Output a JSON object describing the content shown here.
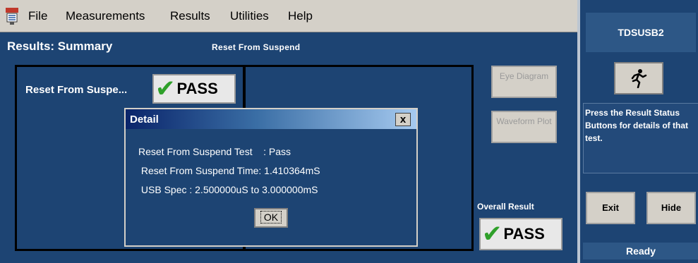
{
  "menu": {
    "items": [
      {
        "label": "File"
      },
      {
        "label": "Measurements"
      },
      {
        "label": "Results"
      },
      {
        "label": "Utilities"
      },
      {
        "label": "Help"
      }
    ]
  },
  "main": {
    "title": "Results: Summary",
    "subtitle": "Reset From Suspend",
    "test": {
      "label": "Reset From Suspe...",
      "result": "PASS"
    },
    "buttons": {
      "eye_diagram": "Eye Diagram",
      "waveform_plot": "Waveform Plot"
    },
    "overall_label": "Overall Result",
    "overall_result": "PASS"
  },
  "dialog": {
    "title": "Detail",
    "close": "x",
    "lines": [
      "Reset From Suspend Test    : Pass",
      " Reset From Suspend Time: 1.410364mS",
      " USB Spec : 2.500000uS to 3.000000mS"
    ],
    "ok": "OK"
  },
  "side_panel": {
    "title": "TDSUSB2",
    "help_text": "Press the Result Status Buttons for details of that test.",
    "exit": "Exit",
    "hide": "Hide",
    "status": "Ready"
  },
  "colors": {
    "background": "#1d4473",
    "pass_check": "#2fa02a"
  },
  "icons": {
    "app": "app-logo-icon",
    "run": "running-man-icon",
    "check": "checkmark-icon"
  }
}
